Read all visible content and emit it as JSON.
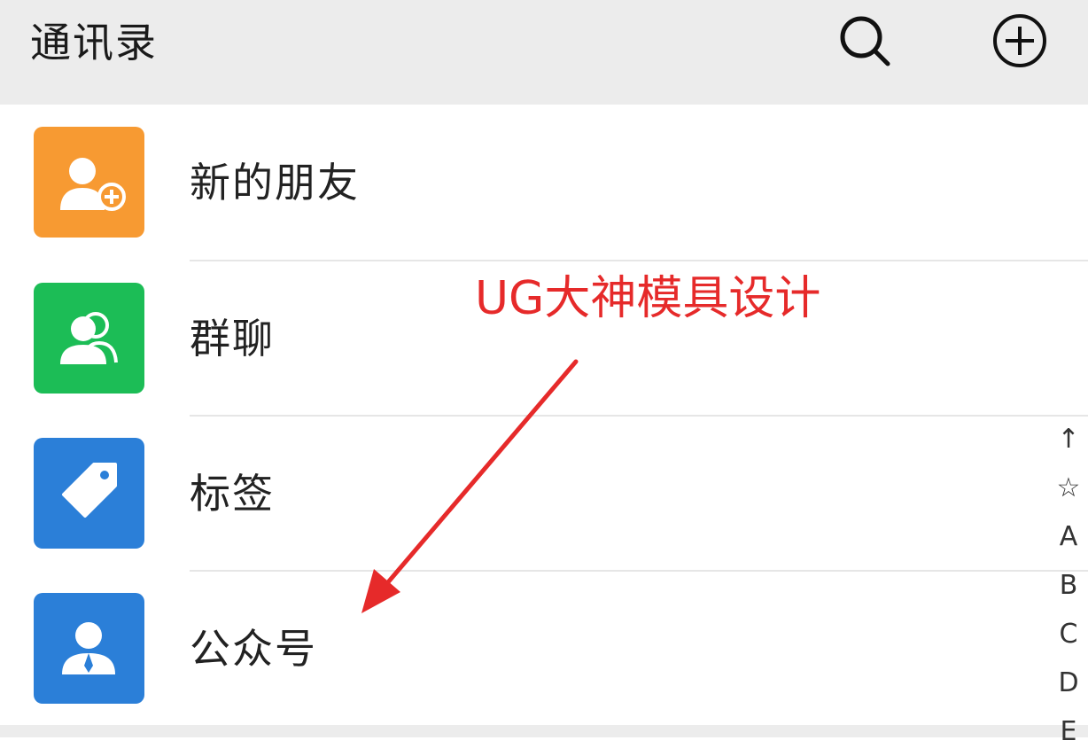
{
  "header": {
    "title": "通讯录",
    "icons": {
      "search": "search-icon",
      "add": "add-circle-icon"
    }
  },
  "list": [
    {
      "label": "新的朋友",
      "icon": "new-friend-icon",
      "color": "#f79a32"
    },
    {
      "label": "群聊",
      "icon": "group-chat-icon",
      "color": "#1cbd56"
    },
    {
      "label": "标签",
      "icon": "tag-icon",
      "color": "#2b7fd8"
    },
    {
      "label": "公众号",
      "icon": "official-account-icon",
      "color": "#2b7fd8"
    }
  ],
  "annotation": {
    "text": "UG大神模具设计",
    "color": "#e62a2a"
  },
  "index_bar": [
    "↑",
    "☆",
    "A",
    "B",
    "C",
    "D",
    "E"
  ],
  "colors": {
    "header_bg": "#ececec",
    "text": "#222222",
    "divider": "#e6e6e6"
  }
}
